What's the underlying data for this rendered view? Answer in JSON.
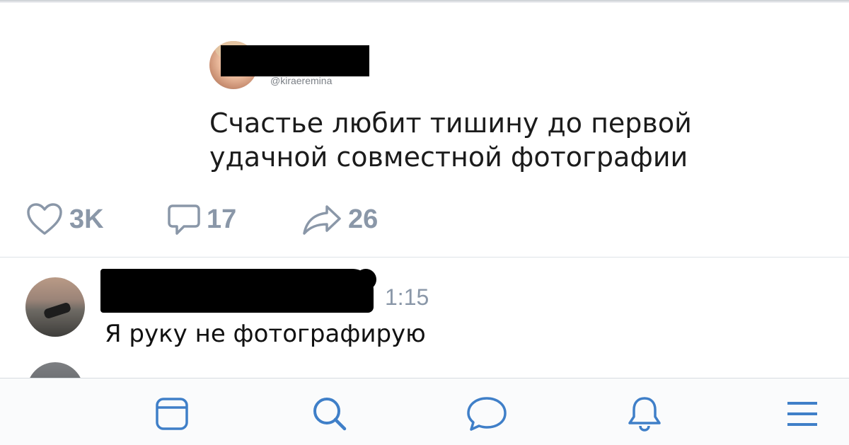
{
  "quote": {
    "handle": "@kiraeremina",
    "text": "Счастье любит тишину до первой удачной совместной фотографии"
  },
  "actions": {
    "likes": "3K",
    "comments": "17",
    "shares": "26"
  },
  "comment": {
    "time": "1:15",
    "text": "Я руку не фотографирую"
  },
  "icons": {
    "like": "heart-icon",
    "comment": "speech-bubble-icon",
    "share": "share-arrow-icon",
    "tab_news": "news-feed-icon",
    "tab_search": "search-icon",
    "tab_messages": "messages-icon",
    "tab_notifications": "bell-icon",
    "tab_menu": "menu-icon"
  },
  "colors": {
    "accent": "#3f7fc8",
    "muted": "#8a97a8"
  }
}
